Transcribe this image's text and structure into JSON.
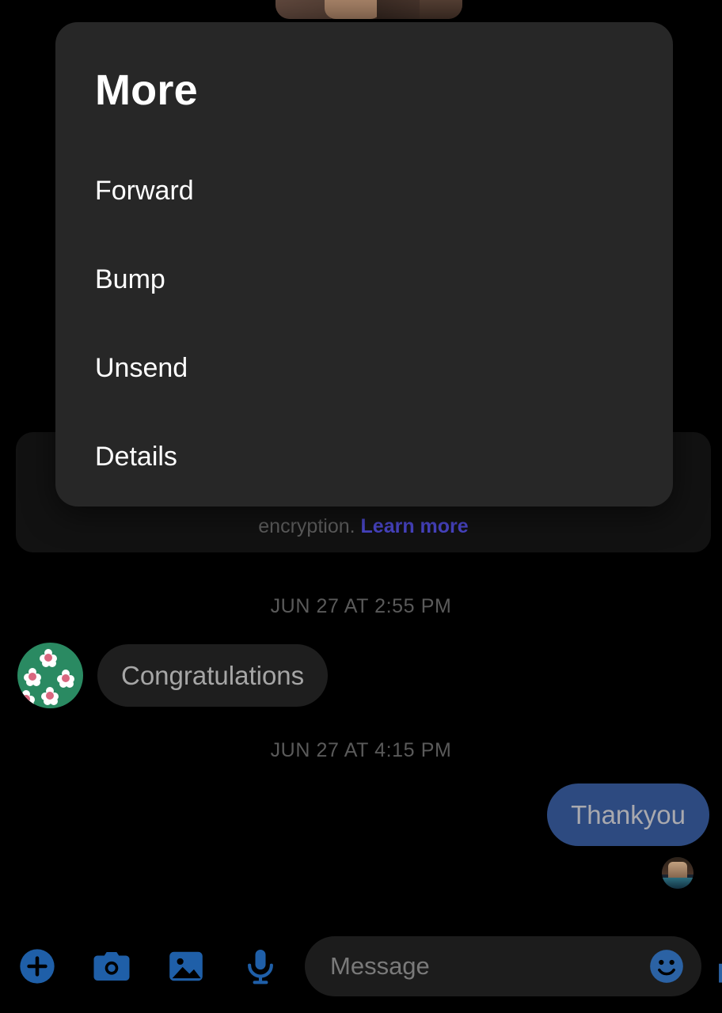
{
  "dialog": {
    "title": "More",
    "items": [
      {
        "label": "Forward",
        "name": "forward"
      },
      {
        "label": "Bump",
        "name": "bump"
      },
      {
        "label": "Unsend",
        "name": "unsend"
      },
      {
        "label": "Details",
        "name": "details"
      }
    ],
    "background_color": "#272727",
    "text_color": "#ffffff"
  },
  "conversation": {
    "encryption_notice": {
      "text": "encryption.",
      "link_label": "Learn more",
      "link_color": "#4a46c9",
      "text_color": "#5e5e5e"
    },
    "separators": [
      {
        "label": "JUN 27 AT 2:55 PM"
      },
      {
        "label": "JUN 27 AT 4:15 PM"
      }
    ],
    "messages": [
      {
        "direction": "incoming",
        "text": "Congratulations",
        "bubble_color": "#1e1e1e",
        "text_color": "#a6a6a6",
        "avatar": "flower-avatar"
      },
      {
        "direction": "outgoing",
        "text": "Thankyou",
        "bubble_color": "#2d4a80",
        "text_color": "#a9a9ae",
        "read_receipt_avatar": "photo-avatar"
      }
    ]
  },
  "composer": {
    "placeholder": "Message",
    "value": "",
    "icon_color": "#1f5fa8",
    "actions": [
      {
        "name": "add-attachment",
        "icon": "plus-circle-icon"
      },
      {
        "name": "camera",
        "icon": "camera-icon"
      },
      {
        "name": "gallery",
        "icon": "image-icon"
      },
      {
        "name": "voice",
        "icon": "microphone-icon"
      }
    ],
    "emoji_icon": "smiley-icon",
    "like_icon": "thumbs-up-icon"
  }
}
